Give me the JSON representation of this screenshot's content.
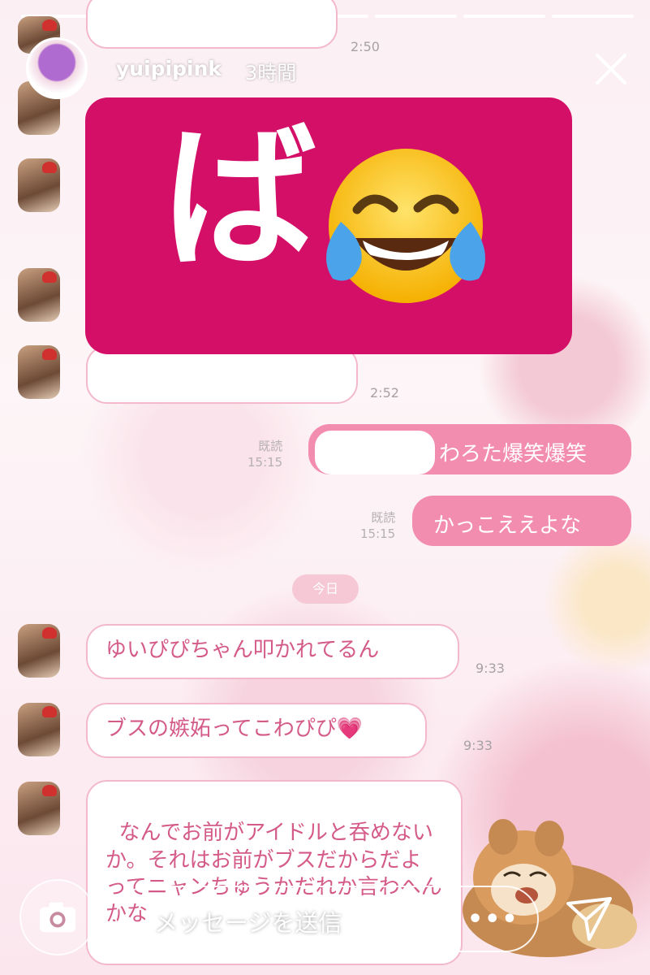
{
  "story": {
    "username": "yuipipink",
    "time": "3時間",
    "progress_segments": 7,
    "active_dot": 0
  },
  "chat": {
    "timestamps_top": [
      "2:50",
      "2:52"
    ],
    "read": [
      {
        "label": "既読",
        "time": "15:15"
      },
      {
        "label": "既読",
        "time": "15:15"
      }
    ],
    "sent": [
      "わろた爆笑爆笑",
      "かっこええよな"
    ],
    "today": "今日",
    "received": [
      {
        "text": "ゆいぴぴちゃん叩かれてるん",
        "time": "9:33"
      },
      {
        "text": "ブスの嫉妬ってこわぴぴ💗",
        "time": "9:33"
      },
      {
        "text": "なんでお前がアイドルと呑めないか。それはお前がブスだからだよ\nってニャンちゅうかだれか言わへんかな",
        "time": ""
      }
    ]
  },
  "overlay": {
    "big_text": "ば",
    "emoji": "face-with-tears-of-joy",
    "color": "#d40f68"
  },
  "footer": {
    "placeholder": "メッセージを送信",
    "more": "•••"
  },
  "colors": {
    "accent": "#f28db0",
    "bubble_border": "#f3b9cb",
    "text_pink": "#d45a88"
  }
}
